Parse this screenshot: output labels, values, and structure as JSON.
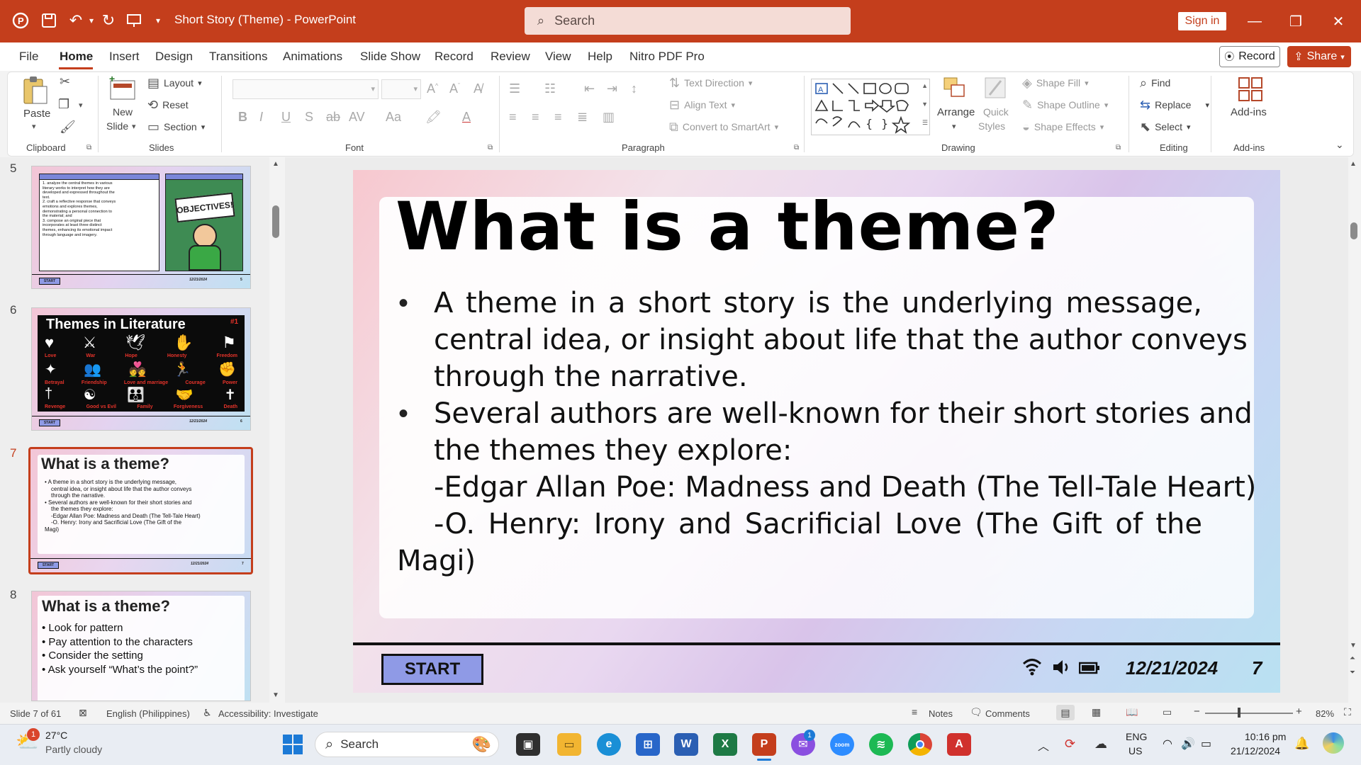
{
  "titlebar": {
    "doc_title": "Short Story (Theme)  -  PowerPoint",
    "search_placeholder": "Search",
    "sign_in": "Sign in"
  },
  "menu": {
    "items": [
      "File",
      "Home",
      "Insert",
      "Design",
      "Transitions",
      "Animations",
      "Slide Show",
      "Record",
      "Review",
      "View",
      "Help",
      "Nitro PDF Pro"
    ],
    "record": "Record",
    "share": "Share"
  },
  "ribbon": {
    "clipboard": {
      "paste": "Paste",
      "label": "Clipboard"
    },
    "slides": {
      "new_slide_1": "New",
      "new_slide_2": "Slide",
      "layout": "Layout",
      "reset": "Reset",
      "section": "Section",
      "label": "Slides"
    },
    "font": {
      "label": "Font"
    },
    "paragraph": {
      "text_direction": "Text Direction",
      "align_text": "Align Text",
      "convert_smartart": "Convert to SmartArt",
      "label": "Paragraph"
    },
    "drawing": {
      "arrange": "Arrange",
      "quick_styles_1": "Quick",
      "quick_styles_2": "Styles",
      "shape_fill": "Shape Fill",
      "shape_outline": "Shape Outline",
      "shape_effects": "Shape Effects",
      "label": "Drawing"
    },
    "editing": {
      "find": "Find",
      "replace": "Replace",
      "select": "Select",
      "label": "Editing"
    },
    "addins": {
      "addins": "Add-ins",
      "label": "Add-ins"
    }
  },
  "thumbnails": [
    {
      "num": "5",
      "title": "",
      "footer_start": "START",
      "footer_date": "12/21/2024",
      "footer_page": "5",
      "lines": [
        "1. analyze the central themes in various",
        "literary works to interpret how they are",
        "developed and expressed throughout the",
        "text.",
        "2. craft a reflective response that conveys",
        "emotions and explores themes,",
        "demonstrating a personal connection to",
        "the material; and",
        "3. compose an original piece that",
        "incorporates at least three distinct",
        "themes, enhancing its emotional impact",
        "through language and imagery."
      ],
      "sign": "OBJECTIVES!"
    },
    {
      "num": "6",
      "title": "Themes in Literature",
      "badge": "#1",
      "footer_start": "START",
      "footer_date": "12/21/2024",
      "footer_page": "6",
      "labels_row1": [
        "Love",
        "War",
        "Hope",
        "Honesty",
        "Freedom"
      ],
      "labels_row2": [
        "Betrayal",
        "Friendship",
        "Love and marriage",
        "Courage",
        "Power"
      ],
      "labels_row3": [
        "Revenge",
        "Good vs Evil",
        "Family",
        "Forgiveness",
        "Death"
      ]
    },
    {
      "num": "7",
      "title": "What is a theme?",
      "footer_start": "START",
      "footer_date": "12/21/2024",
      "footer_page": "7",
      "lines": [
        "• A theme in a short story is the underlying message,",
        "central idea, or insight about life that the author conveys",
        "through the narrative.",
        "• Several authors are well-known for their short stories and",
        "the themes they explore:",
        "-Edgar Allan Poe: Madness and Death (The Tell-Tale Heart)",
        "-O. Henry: Irony and Sacrificial Love (The Gift of the",
        "Magi)"
      ]
    },
    {
      "num": "8",
      "title": "What is a theme?",
      "lines": [
        "• Look for pattern",
        "• Pay attention to the characters",
        "• Consider the setting",
        "• Ask yourself “What’s the point?”"
      ]
    }
  ],
  "slide": {
    "title": "What is a theme?",
    "lines": [
      "A theme in a short story is the underlying message,",
      "central idea, or insight about life that the author conveys",
      "through the narrative.",
      "Several authors are well-known for their short stories and",
      "the themes they explore:",
      "-Edgar Allan Poe: Madness and Death (The Tell-Tale Heart)",
      "-O. Henry: Irony and Sacrificial Love (The Gift of the",
      "Magi)"
    ],
    "bullet": "•",
    "start": "START",
    "date": "12/21/2024",
    "page": "7"
  },
  "statusbar": {
    "slide_of": "Slide 7 of 61",
    "language": "English (Philippines)",
    "accessibility": "Accessibility: Investigate",
    "notes": "Notes",
    "comments": "Comments",
    "zoom": "82%"
  },
  "taskbar": {
    "temp": "27°C",
    "weather": "Partly cloudy",
    "search": "Search",
    "lang1": "ENG",
    "lang2": "US",
    "time": "10:16 pm",
    "date": "21/12/2024",
    "weather_badge": "1",
    "messenger_badge": "1"
  }
}
